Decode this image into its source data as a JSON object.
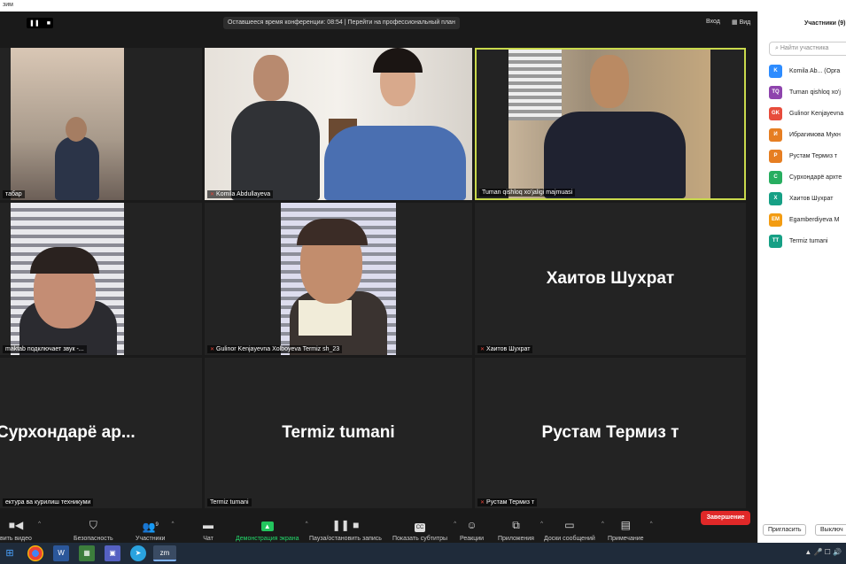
{
  "window": {
    "title": "зим"
  },
  "topbar": {
    "rec_pause": "❚❚",
    "rec_stop": "■",
    "timer": "Оставшееся время конференции: 08:54 | Перейти на профессиональный план",
    "enter": "Вход",
    "view": "Вид"
  },
  "tiles": [
    {
      "name": "табар",
      "big": ""
    },
    {
      "name": "Komila Abdullayeva",
      "big": ""
    },
    {
      "name": "Tuman qishloq xo'jaligi majmuasi",
      "big": ""
    },
    {
      "name": "maktab подключает звук -...",
      "big": ""
    },
    {
      "name": "Gulinor Kenjayevna Xolboyeva Termiz sh_23",
      "big": ""
    },
    {
      "name": "Хаитов Шухрат",
      "big": "Хаитов Шухрат"
    },
    {
      "name": "ектура ва курилиш техникуми",
      "big": "Сурхондарё ар..."
    },
    {
      "name": "Termiz tumani",
      "big": "Termiz tumani"
    },
    {
      "name": "Рустам Термиз т",
      "big": "Рустам Термиз т"
    }
  ],
  "toolbar": {
    "video": "вить видео",
    "security": "Безопасность",
    "participants": "Участники",
    "participants_count": "9",
    "chat": "Чат",
    "share": "Демонстрация экрана",
    "pause": "Пауза/остановить запись",
    "captions": "Показать субтитры",
    "reactions": "Реакции",
    "apps": "Приложения",
    "whiteboards": "Доски сообщений",
    "notes": "Примечание",
    "end": "Завершение",
    "cc": "CC"
  },
  "panel": {
    "title": "Участники (9)",
    "search_placeholder": "Найти участника",
    "participants": [
      {
        "initials": "K",
        "name": "Komila Ab... (Орга",
        "color": "#2d8cff"
      },
      {
        "initials": "TQ",
        "name": "Tuman qishloq xo'j",
        "color": "#8e44ad"
      },
      {
        "initials": "GK",
        "name": "Gulinor Kenjayevna",
        "color": "#e74c3c"
      },
      {
        "initials": "И",
        "name": "Ибрагимова Мукн",
        "color": "#e67e22"
      },
      {
        "initials": "Р",
        "name": "Рустам Термиз т",
        "color": "#e67e22"
      },
      {
        "initials": "С",
        "name": "Сурхондарё архте",
        "color": "#27ae60"
      },
      {
        "initials": "Х",
        "name": "Хаитов Шухрат",
        "color": "#16a085"
      },
      {
        "initials": "EM",
        "name": "Egamberdiyeva M",
        "color": "#f39c12"
      },
      {
        "initials": "TT",
        "name": "Termiz tumani",
        "color": "#16a085"
      }
    ],
    "invite": "Пригласить",
    "mute_all": "Выключ"
  },
  "taskbar": {
    "zoom_label": "zm",
    "word_label": "W",
    "tray": "▲ 🎤 ☐ 🔊"
  }
}
